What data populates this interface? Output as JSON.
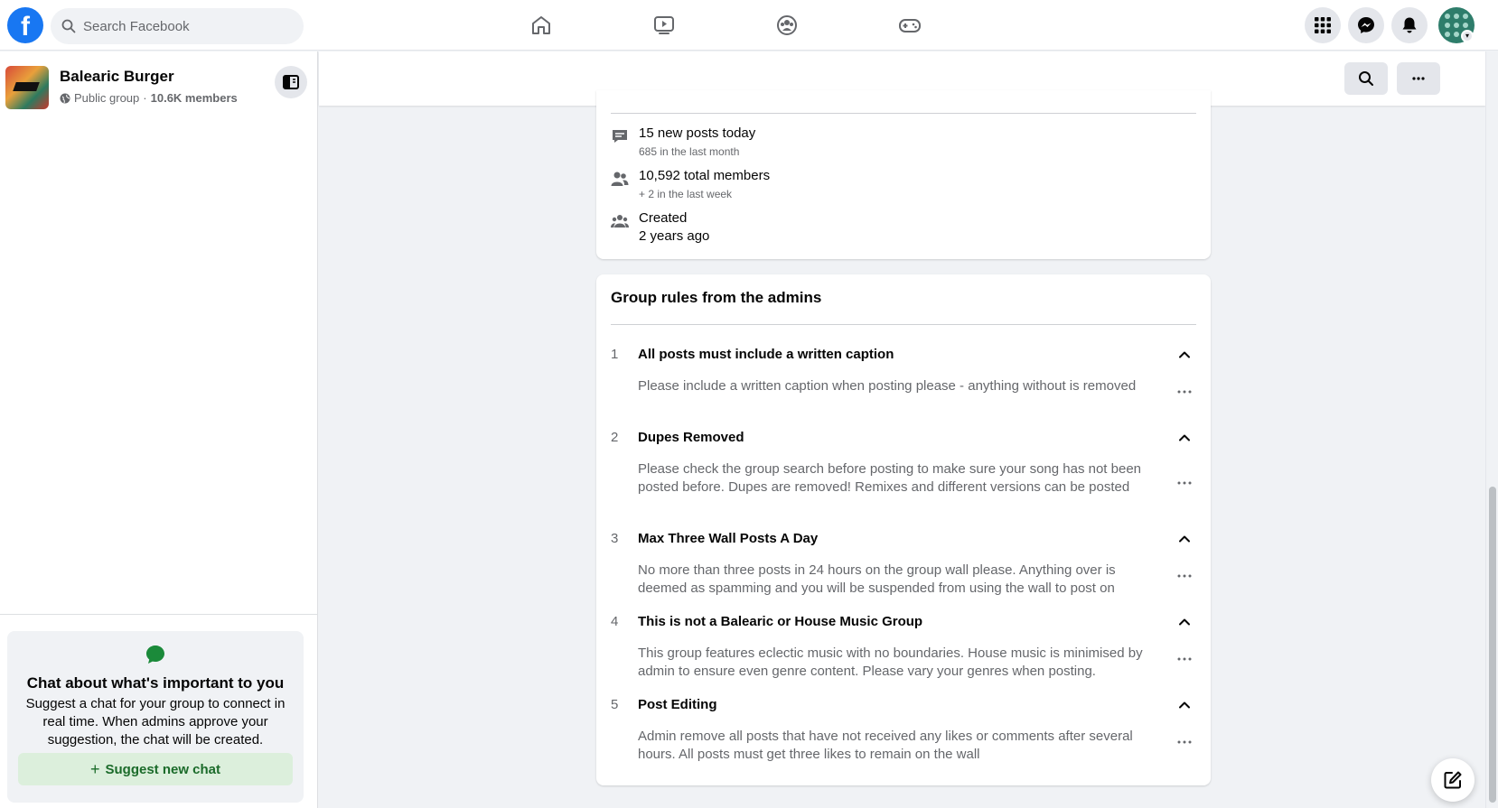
{
  "topbar": {
    "logo": "f",
    "search_placeholder": "Search Facebook",
    "nav_icons": [
      "home-icon",
      "watch-icon",
      "groups-icon",
      "gaming-icon"
    ],
    "right_icons": [
      "menu-grid-icon",
      "messenger-icon",
      "notifications-icon"
    ]
  },
  "group": {
    "name": "Balearic Burger",
    "privacy": "Public group",
    "separator": "·",
    "members": "10.6K members"
  },
  "chat_card": {
    "title": "Chat about what's important to you",
    "description": "Suggest a chat for your group to connect in real time. When admins approve your suggestion, the chat will be created.",
    "button_icon": "+",
    "button_label": "Suggest new chat"
  },
  "stats": [
    {
      "icon": "posts-icon",
      "main": "15 new posts today",
      "sub": "685 in the last month"
    },
    {
      "icon": "members-icon",
      "main": "10,592 total members",
      "sub": "+ 2 in the last week"
    },
    {
      "icon": "created-icon",
      "main": "Created",
      "sub": "2 years ago"
    }
  ],
  "rules": {
    "title": "Group rules from the admins",
    "items": [
      {
        "num": "1",
        "title": "All posts must include a written caption",
        "desc": "Please include a written caption when posting please - anything without is removed"
      },
      {
        "num": "2",
        "title": "Dupes Removed",
        "desc": "Please check the group search before posting to make sure your song has not been posted before. Dupes are removed! Remixes and different versions can be posted"
      },
      {
        "num": "3",
        "title": "Max Three Wall Posts A Day",
        "desc": "No more than three posts in 24 hours on the group wall please. Anything over is deemed as spamming and you will be suspended from using the wall to post on"
      },
      {
        "num": "4",
        "title": "This is not a Balearic or House Music Group",
        "desc": "This group features eclectic music with no boundaries. House music is minimised by admin to ensure even genre content. Please vary your genres when posting."
      },
      {
        "num": "5",
        "title": "Post Editing",
        "desc": "Admin remove all posts that have not received any likes or comments after several hours. All posts must get three likes to remain on the wall"
      }
    ]
  },
  "colors": {
    "brand": "#1877f2",
    "chat_green": "#1b8a3a",
    "suggest_bg": "#dcefdc"
  }
}
